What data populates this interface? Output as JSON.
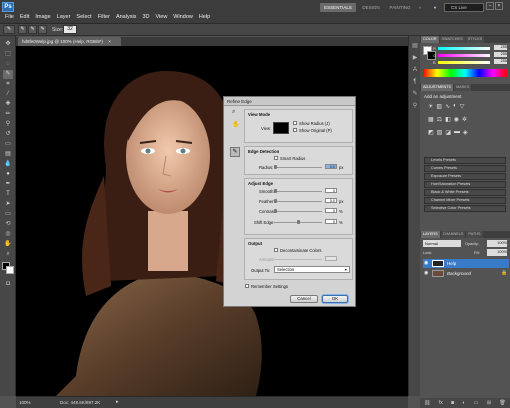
{
  "app": {
    "logo": "Ps"
  },
  "menu": [
    "File",
    "Edit",
    "Image",
    "Layer",
    "Select",
    "Filter",
    "Analysis",
    "3D",
    "View",
    "Window",
    "Help"
  ],
  "workspaces": {
    "essentials": "ESSENTIALS",
    "design": "DESIGN",
    "painting": "PAINTING",
    "more": "»"
  },
  "cs_live": "CS Live",
  "options": {
    "size_label": "Size:",
    "size_value": "32"
  },
  "document": {
    "tab_title": "hd9fe0Welp.jpg @ 100% (Help, RGB/8*)",
    "close": "×"
  },
  "status": {
    "zoom": "100%",
    "doc": "Doc: 448.6K/897.2K"
  },
  "color_panel": {
    "tabs": [
      "COLOR",
      "SWATCHES",
      "STYLES"
    ],
    "channels": [
      "R",
      "G",
      "B"
    ],
    "values": [
      "255",
      "255",
      "255"
    ]
  },
  "adjustments_panel": {
    "tabs": [
      "ADJUSTMENTS",
      "MASKS"
    ],
    "heading": "Add an adjustment",
    "presets": [
      "Levels Presets",
      "Curves Presets",
      "Exposure Presets",
      "Hue/Saturation Presets",
      "Black & White Presets",
      "Channel Mixer Presets",
      "Selective Color Presets"
    ]
  },
  "layers_panel": {
    "tabs": [
      "LAYERS",
      "CHANNELS",
      "PATHS"
    ],
    "blend": "Normal",
    "opacity_label": "Opacity:",
    "opacity": "100%",
    "lock_label": "Lock:",
    "fill_label": "Fill:",
    "fill": "100%",
    "layers": [
      {
        "name": "Help",
        "selected": true
      },
      {
        "name": "Background",
        "selected": false
      }
    ]
  },
  "refine_edge": {
    "title": "Refine Edge",
    "view_mode": {
      "heading": "View Mode",
      "view_label": "View:",
      "show_radius": "Show Radius (J)",
      "show_original": "Show Original (P)"
    },
    "edge_detection": {
      "heading": "Edge Detection",
      "smart_radius": "Smart Radius",
      "radius_label": "Radius:",
      "radius_value": "0.0",
      "radius_unit": "px"
    },
    "adjust_edge": {
      "heading": "Adjust Edge",
      "smooth_label": "Smooth:",
      "smooth_value": "0",
      "feather_label": "Feather:",
      "feather_value": "0.0",
      "feather_unit": "px",
      "contrast_label": "Contrast:",
      "contrast_value": "0",
      "contrast_unit": "%",
      "shift_label": "Shift Edge:",
      "shift_value": "0",
      "shift_unit": "%"
    },
    "output": {
      "heading": "Output",
      "decontaminate": "Decontaminate Colors",
      "amount_label": "Amount:",
      "output_to_label": "Output To:",
      "output_to_value": "Selection"
    },
    "remember": "Remember Settings",
    "cancel": "Cancel",
    "ok": "OK"
  },
  "colors": {
    "accent": "#4a8fd4",
    "canvas": "#000000",
    "ui_dark": "#3c3c3c"
  }
}
